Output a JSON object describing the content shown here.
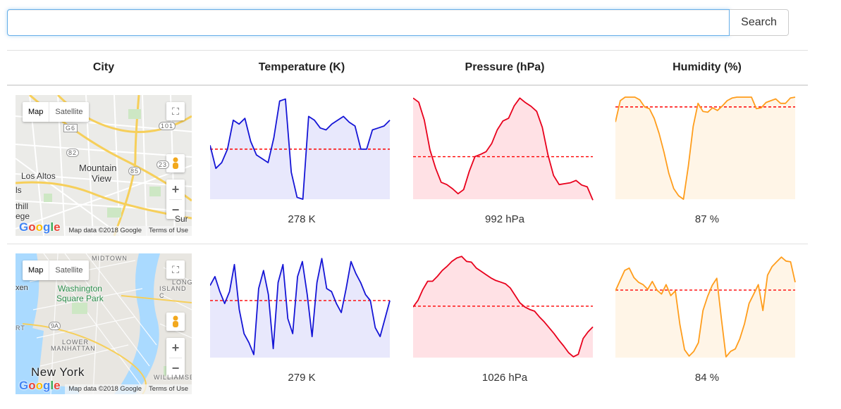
{
  "search": {
    "value": "",
    "placeholder": "",
    "button_label": "Search"
  },
  "table": {
    "headers": [
      "City",
      "Temperature (K)",
      "Pressure (hPa)",
      "Humidity (%)"
    ],
    "rows": [
      {
        "map": {
          "type_map": "Map",
          "type_satellite": "Satellite",
          "labels": [
            "Mountain",
            "View",
            "Los Altos",
            "G6",
            "101",
            "82",
            "85",
            "23",
            "ls",
            "thill",
            "ege",
            "Sur"
          ],
          "logo": [
            "G",
            "o",
            "o",
            "g",
            "l",
            "e"
          ],
          "map_data": "Map data ©2018 Google",
          "terms": "Terms of Use",
          "zoom_in": "+",
          "zoom_out": "−"
        },
        "temperature": {
          "display": "278 K",
          "color": "#1515d6",
          "fill": "rgba(80,80,230,0.13)",
          "values": [
            276.3,
            275.1,
            275.4,
            276.1,
            277.6,
            277.4,
            277.7,
            276.5,
            275.8,
            275.6,
            275.4,
            276.7,
            278.6,
            278.7,
            274.9,
            273.6,
            273.5,
            277.8,
            277.6,
            277.2,
            277.1,
            277.4,
            277.6,
            277.8,
            277.5,
            277.3,
            276.1,
            276.1,
            277.1,
            277.2,
            277.3,
            277.6
          ],
          "average": 276.1,
          "y_range": [
            273.5,
            278.8
          ],
          "chart_type": "area",
          "average_line_color": "#ff0000"
        },
        "pressure": {
          "display": "992 hPa",
          "color": "#e8001c",
          "fill": "rgba(255,80,100,0.17)",
          "values": [
            1015.1,
            1014.2,
            1010.3,
            1003.8,
            999.8,
            996.7,
            996.2,
            995.3,
            994.2,
            995.1,
            999.1,
            1002.3,
            1002.8,
            1003.4,
            1005.2,
            1008.2,
            1010.1,
            1010.7,
            1013.4,
            1015.1,
            1014.1,
            1013.3,
            1012.2,
            1008.7,
            1002.7,
            998.2,
            996.2,
            996.4,
            996.6,
            997.1,
            996.1,
            995.7,
            992.8
          ],
          "average": 1002.3,
          "y_range": [
            993.0,
            1015.3
          ],
          "chart_type": "area",
          "average_line_color": "#ff0000"
        },
        "humidity": {
          "display": "87 %",
          "color": "#ff9d1c",
          "fill": "rgba(255,170,60,0.12)",
          "values": [
            87.1,
            89.5,
            89.9,
            89.9,
            89.9,
            89.6,
            88.8,
            88.6,
            87.5,
            85.8,
            83.7,
            81.3,
            79.6,
            78.8,
            78.4,
            82.1,
            86.6,
            89.2,
            88.3,
            88.2,
            88.7,
            88.4,
            88.9,
            89.5,
            89.8,
            89.9,
            89.9,
            89.9,
            89.9,
            88.6,
            88.7,
            89.3,
            89.5,
            89.7,
            89.2,
            89.2,
            89.8,
            89.9
          ],
          "average": 88.8,
          "y_range": [
            78.4,
            89.9
          ],
          "chart_type": "area",
          "average_line_color": "#ff0000"
        }
      },
      {
        "map": {
          "type_map": "Map",
          "type_satellite": "Satellite",
          "labels": [
            "MIDTOWN",
            "Washington",
            "Square Park",
            "LONG",
            "ISLAND C",
            "9A",
            "LOWER",
            "MANHATTAN",
            "New York",
            "xen",
            "RT",
            "WILLIAMSBUR"
          ],
          "logo": [
            "G",
            "o",
            "o",
            "g",
            "l",
            "e"
          ],
          "map_data": "Map data ©2018 Google",
          "terms": "Terms of Use",
          "zoom_in": "+",
          "zoom_out": "−"
        },
        "temperature": {
          "display": "279 K",
          "color": "#1515d6",
          "fill": "rgba(80,80,230,0.13)",
          "values": [
            279.2,
            279.5,
            279.0,
            278.6,
            279.0,
            279.9,
            278.4,
            277.6,
            277.3,
            276.9,
            279.1,
            279.7,
            278.9,
            277.1,
            279.3,
            279.9,
            278.1,
            277.6,
            279.5,
            280.0,
            278.9,
            277.5,
            279.3,
            280.1,
            279.1,
            279.0,
            278.6,
            278.3,
            279.1,
            280.0,
            279.6,
            279.3,
            278.9,
            278.7,
            277.8,
            277.5,
            278.1,
            278.7
          ],
          "average": 278.7,
          "y_range": [
            276.8,
            280.2
          ],
          "chart_type": "area",
          "average_line_color": "#ff0000"
        },
        "pressure": {
          "display": "1026 hPa",
          "color": "#e8001c",
          "fill": "rgba(255,80,100,0.17)",
          "values": [
            1026.1,
            1026.9,
            1028.2,
            1029.2,
            1029.2,
            1029.8,
            1030.5,
            1031.0,
            1031.6,
            1032.0,
            1032.2,
            1031.6,
            1031.5,
            1030.8,
            1030.4,
            1030.0,
            1029.6,
            1029.3,
            1029.1,
            1028.9,
            1028.4,
            1027.5,
            1026.6,
            1026.1,
            1025.8,
            1025.6,
            1024.9,
            1024.3,
            1023.6,
            1022.9,
            1022.1,
            1021.4,
            1020.6,
            1020.1,
            1020.4,
            1022.3,
            1023.1,
            1023.7
          ],
          "average": 1026.2,
          "y_range": [
            1020.0,
            1032.3
          ],
          "chart_type": "area",
          "average_line_color": "#ff0000"
        },
        "humidity": {
          "display": "84 %",
          "color": "#ff9d1c",
          "fill": "rgba(255,170,60,0.12)",
          "values": [
            84.8,
            86.1,
            87.4,
            87.7,
            86.5,
            85.9,
            85.6,
            85.0,
            86.0,
            84.9,
            84.4,
            85.6,
            84.2,
            84.8,
            80.5,
            77.3,
            76.5,
            77.1,
            78.2,
            82.3,
            84.1,
            85.5,
            86.4,
            81.2,
            76.4,
            77.1,
            77.4,
            78.7,
            80.6,
            83.2,
            84.4,
            85.6,
            82.3,
            86.8,
            87.9,
            88.5,
            89.1,
            88.6,
            88.5,
            85.9
          ],
          "average": 84.9,
          "y_range": [
            76.3,
            89.3
          ],
          "chart_type": "area",
          "average_line_color": "#ff0000"
        }
      }
    ]
  }
}
